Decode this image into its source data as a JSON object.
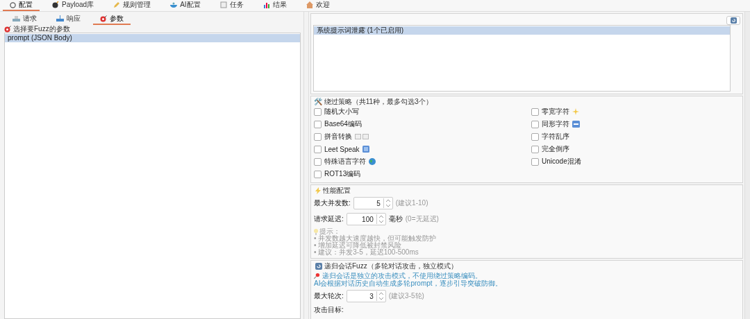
{
  "top_tabs": [
    {
      "label": "配置",
      "selected": true
    },
    {
      "label": "Payload库",
      "selected": false
    },
    {
      "label": "规则管理",
      "selected": false
    },
    {
      "label": "AI配置",
      "selected": false
    },
    {
      "label": "任务",
      "selected": false
    },
    {
      "label": "结果",
      "selected": false
    },
    {
      "label": "欢迎",
      "selected": false
    }
  ],
  "sub_tabs": [
    {
      "label": "请求",
      "selected": false
    },
    {
      "label": "响应",
      "selected": false
    },
    {
      "label": "参数",
      "selected": true
    }
  ],
  "params": {
    "title": "选择要Fuzz的参数",
    "items": [
      {
        "label": "prompt (JSON Body)",
        "selected": true
      }
    ]
  },
  "rules": {
    "items": [
      {
        "label": "系统提示词泄露 (1个已启用)",
        "selected": true
      }
    ]
  },
  "strategies": {
    "title": "🛠️ 绕过策略（共11种，最多勾选3个）",
    "columns": [
      [
        {
          "label": "随机大小写",
          "checked": false,
          "kind": "plain"
        },
        {
          "label": "Base64编码",
          "checked": false,
          "kind": "plain"
        },
        {
          "label": "拼音转换",
          "checked": false,
          "kind": "tiles"
        },
        {
          "label": "Leet Speak",
          "checked": false,
          "kind": "numbers"
        },
        {
          "label": "特殊语言字符",
          "checked": false,
          "kind": "globe"
        },
        {
          "label": "ROT13编码",
          "checked": false,
          "kind": "plain"
        }
      ],
      [
        {
          "label": "零宽字符",
          "checked": false,
          "kind": "sparkle"
        },
        {
          "label": "同形字符",
          "checked": false,
          "kind": "keys"
        },
        {
          "label": "字符乱序",
          "checked": false,
          "kind": "plain"
        },
        {
          "label": "完全倒序",
          "checked": false,
          "kind": "plain"
        },
        {
          "label": "Unicode混淆",
          "checked": false,
          "kind": "plain"
        }
      ]
    ]
  },
  "performance": {
    "title": "性能配置",
    "fields": [
      {
        "label": "最大并发数:",
        "value": "5",
        "hint": "(建议1-10)"
      },
      {
        "label": "请求延迟:",
        "value": "100",
        "unit": "毫秒",
        "hint": "(0=无延迟)"
      }
    ],
    "tips": {
      "title": "提示：",
      "items": [
        "• 并发数越大速度越快，但可能触发防护",
        "• 增加延迟可降低被封禁风险",
        "• 建议：并发3-5，延迟100-500ms"
      ]
    }
  },
  "recursive": {
    "title": "递归会话Fuzz（多轮对话攻击，独立模式）",
    "notes": [
      "递归会话是独立的攻击模式，不使用绕过策略编码。",
      "AI会根据对话历史自动生成多轮prompt，逐步引导突破防御。"
    ],
    "fields": [
      {
        "label": "最大轮次:",
        "value": "3",
        "hint": "(建议3-5轮)"
      }
    ],
    "target_label": "攻击目标:"
  }
}
